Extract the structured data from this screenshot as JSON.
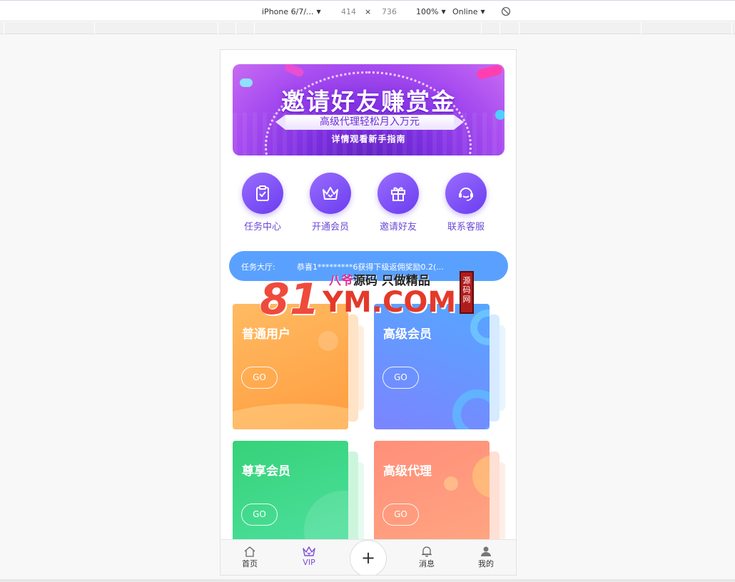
{
  "devtools": {
    "device": "iPhone 6/7/...",
    "width": "414",
    "times": "×",
    "height": "736",
    "zoom": "100%",
    "network": "Online"
  },
  "banner": {
    "title": "邀请好友赚赏金",
    "subtitle": "高级代理轻松月入万元",
    "caption": "详情观看新手指南"
  },
  "quick_nav": [
    {
      "label": "任务中心",
      "icon": "clipboard-check-icon"
    },
    {
      "label": "开通会员",
      "icon": "crown-icon"
    },
    {
      "label": "邀请好友",
      "icon": "gift-icon"
    },
    {
      "label": "联系客服",
      "icon": "headset-icon"
    }
  ],
  "notice": {
    "label": "任务大厅:",
    "message": "恭喜1*********6获得下级返佣奖励0.2(..."
  },
  "watermark": {
    "number": "81",
    "domain": "YM.COM",
    "slogan_a": "八爷",
    "slogan_b": "源码 只做精品",
    "seal": "源码网"
  },
  "cards": [
    {
      "title": "普通用户",
      "go": "GO",
      "color_start": "#ffb35a",
      "color_end": "#ff9a3c"
    },
    {
      "title": "高级会员",
      "go": "GO",
      "color_start": "#5a9dff",
      "color_end": "#7a86ff"
    },
    {
      "title": "尊享会员",
      "go": "GO",
      "color_start": "#3ed47a",
      "color_end": "#4be0a0"
    },
    {
      "title": "高级代理",
      "go": "GO",
      "color_start": "#ff8f7a",
      "color_end": "#ffa67e"
    }
  ],
  "tabbar": {
    "home": "首页",
    "vip": "VIP",
    "plus": "+",
    "messages": "消息",
    "mine": "我的"
  },
  "colors": {
    "accent": "#7b4bd8",
    "notice_bg": "#5aa1ff"
  }
}
